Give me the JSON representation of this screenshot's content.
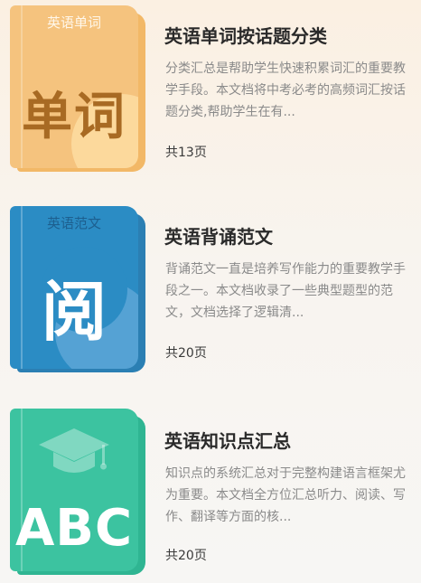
{
  "items": [
    {
      "cover_label": "英语单词",
      "cover_text": "单词",
      "cover_color": "#f5c37e",
      "title": "英语单词按话题分类",
      "description": "分类汇总是帮助学生快速积累词汇的重要教学手段。本文档将中考必考的高频词汇按话题分类,帮助学生在有...",
      "pages": "共13页"
    },
    {
      "cover_label": "英语范文",
      "cover_text": "阅",
      "cover_color": "#2b8cc4",
      "title": "英语背诵范文",
      "description": "背诵范文一直是培养写作能力的重要教学手段之一。本文档收录了一些典型题型的范文，文档选择了逻辑清...",
      "pages": "共20页"
    },
    {
      "cover_label": "",
      "cover_text": "ABC",
      "cover_icon": "graduation-cap-icon",
      "cover_color": "#3cc3a0",
      "title": "英语知识点汇总",
      "description": "知识点的系统汇总对于完整构建语言框架尤为重要。本文档全方位汇总听力、阅读、写作、翻译等方面的核...",
      "pages": "共20页"
    }
  ]
}
